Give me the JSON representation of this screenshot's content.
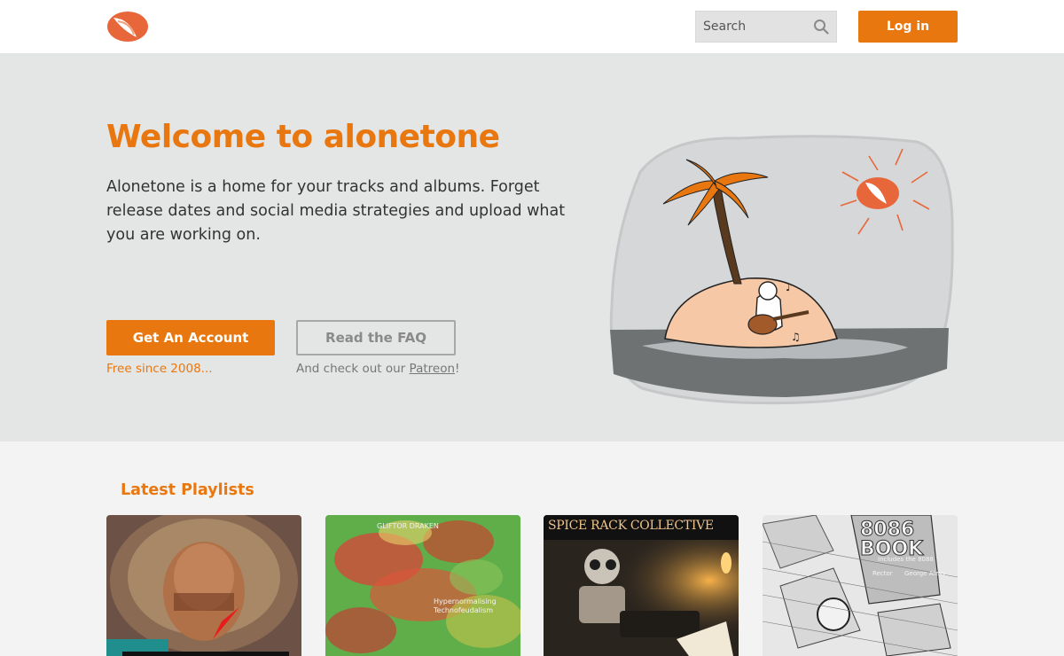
{
  "header": {
    "logo": "alonetone-logo-icon",
    "search_placeholder": "Search",
    "login_label": "Log in"
  },
  "hero": {
    "title": "Welcome to alonetone",
    "text": "Alonetone is a home for your tracks and albums. Forget release dates and social media strategies and upload what you are working on.",
    "cta_primary": "Get An Account",
    "cta_secondary": "Read the FAQ",
    "free_note": "Free since 2008...",
    "patreon_prefix": "And check out our ",
    "patreon_link": "Patreon",
    "patreon_suffix": "!",
    "illustration": "island-palm-tree-ukulele-illustration"
  },
  "playlists": {
    "heading": "Latest Playlists",
    "items": [
      {
        "cover": "portrait-big-hair-cover",
        "text": ""
      },
      {
        "cover": "red-green-noise-cover",
        "top_text": "GLIFTOR DRAKEN",
        "text": "Hypernormalising Technofeudalism"
      },
      {
        "cover": "robot-typewriter-cover",
        "text": "SPICE RACK COLLECTIVE"
      },
      {
        "cover": "8086-book-sketch-cover",
        "title": "8086 BOOK",
        "subtitle": "Includes the 8088",
        "credit": "Rector",
        "author": "George Alexy"
      }
    ]
  },
  "colors": {
    "accent": "#e8770f",
    "hero_bg": "#e4e5e5",
    "page_bg": "#f3f3f3"
  }
}
